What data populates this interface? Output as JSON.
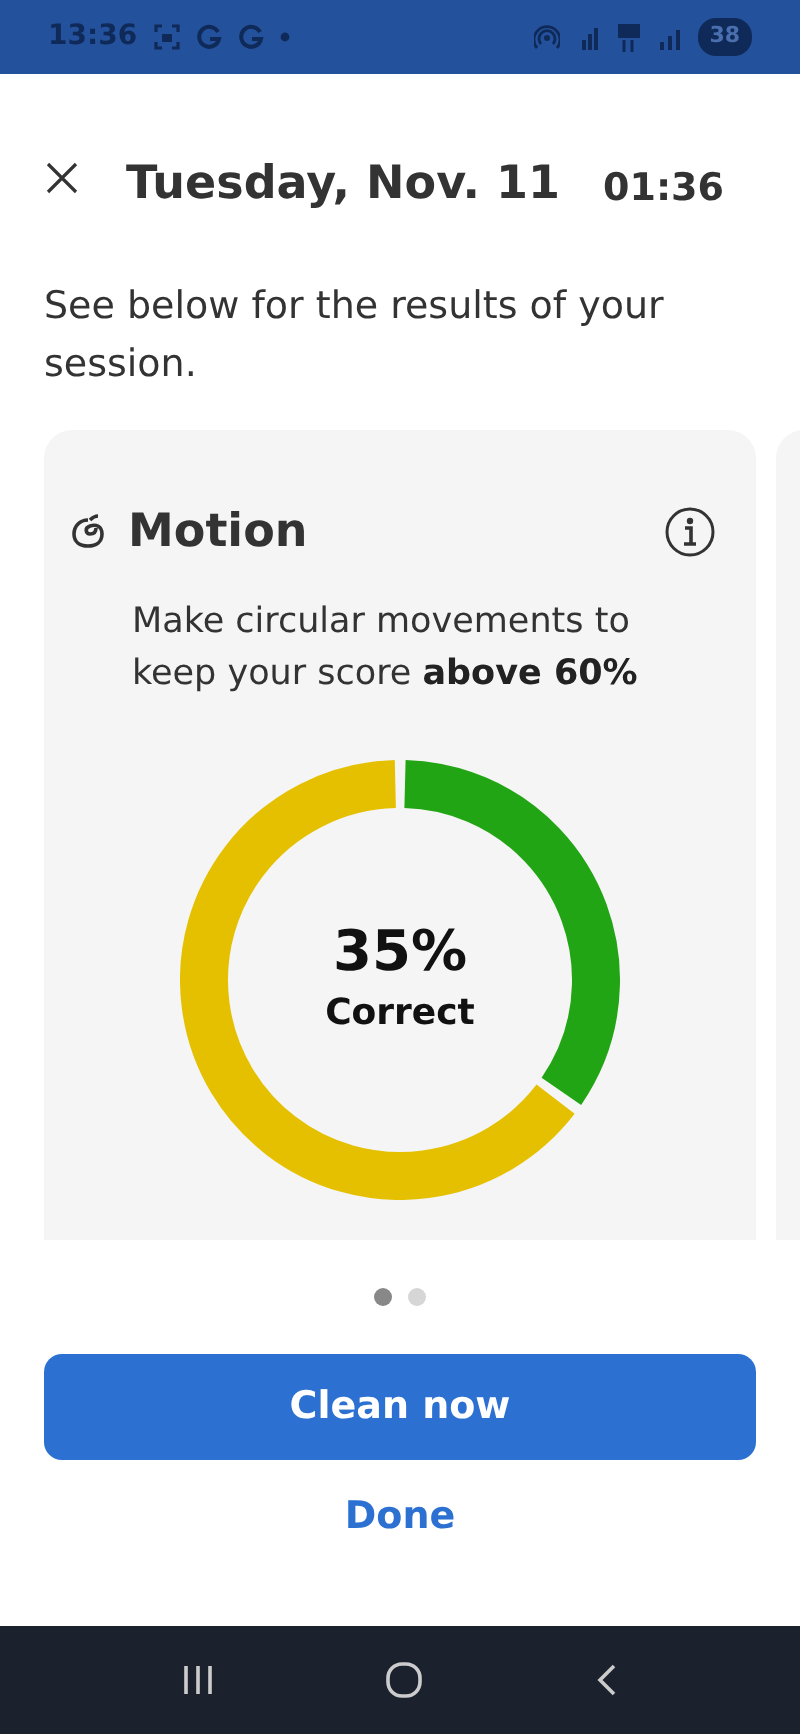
{
  "status_bar": {
    "time": "13:36",
    "battery": "38"
  },
  "header": {
    "title": "Tuesday, Nov. 11",
    "duration": "01:36"
  },
  "intro": "See below for the results of your session.",
  "cards": [
    {
      "title": "Motion",
      "description": "Make circular movements to keep your score **above 60%**",
      "score": {
        "level": 0.35,
        "value": "35%",
        "label": "Correct"
      }
    }
  ],
  "pager": [
    {
      "selected": true
    },
    {
      "selected": false
    }
  ],
  "primary_button": "Clean now",
  "secondary_button": "Done"
}
